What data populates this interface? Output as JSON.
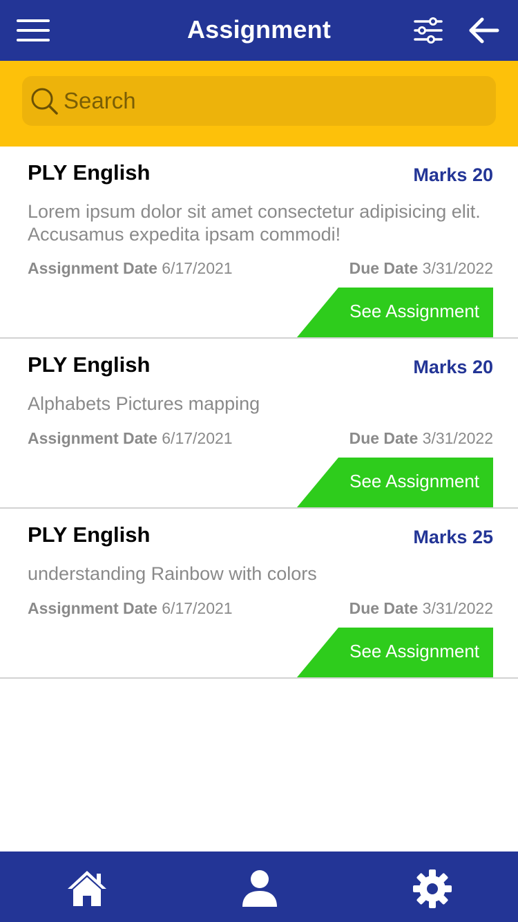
{
  "header": {
    "title": "Assignment",
    "menu_icon": "hamburger-menu-icon",
    "filter_icon": "sliders-icon",
    "back_icon": "arrow-left-icon"
  },
  "search": {
    "placeholder": "Search",
    "value": "",
    "icon": "search-icon"
  },
  "assignments": [
    {
      "subject": "PLY English",
      "marks_label": "Marks 20",
      "description": "Lorem ipsum dolor sit amet consectetur adipisicing elit. Accusamus expedita ipsam commodi!",
      "assignment_date_label": "Assignment Date",
      "assignment_date": "6/17/2021",
      "due_date_label": "Due Date",
      "due_date": "3/31/2022",
      "button_label": "See Assignment"
    },
    {
      "subject": "PLY English",
      "marks_label": "Marks 20",
      "description": "Alphabets Pictures mapping",
      "assignment_date_label": "Assignment Date",
      "assignment_date": "6/17/2021",
      "due_date_label": "Due Date",
      "due_date": "3/31/2022",
      "button_label": "See Assignment"
    },
    {
      "subject": "PLY English",
      "marks_label": "Marks 25",
      "description": "understanding Rainbow with colors",
      "assignment_date_label": "Assignment Date",
      "assignment_date": "6/17/2021",
      "due_date_label": "Due Date",
      "due_date": "3/31/2022",
      "button_label": "See Assignment"
    }
  ],
  "bottom_nav": {
    "items": [
      {
        "icon": "home-icon"
      },
      {
        "icon": "user-icon"
      },
      {
        "icon": "gear-icon"
      }
    ]
  },
  "colors": {
    "primary": "#233596",
    "search_band": "#fdc10a",
    "search_box": "#edb30b",
    "button": "#2ecc1c",
    "text_muted": "#8a8a8a"
  }
}
